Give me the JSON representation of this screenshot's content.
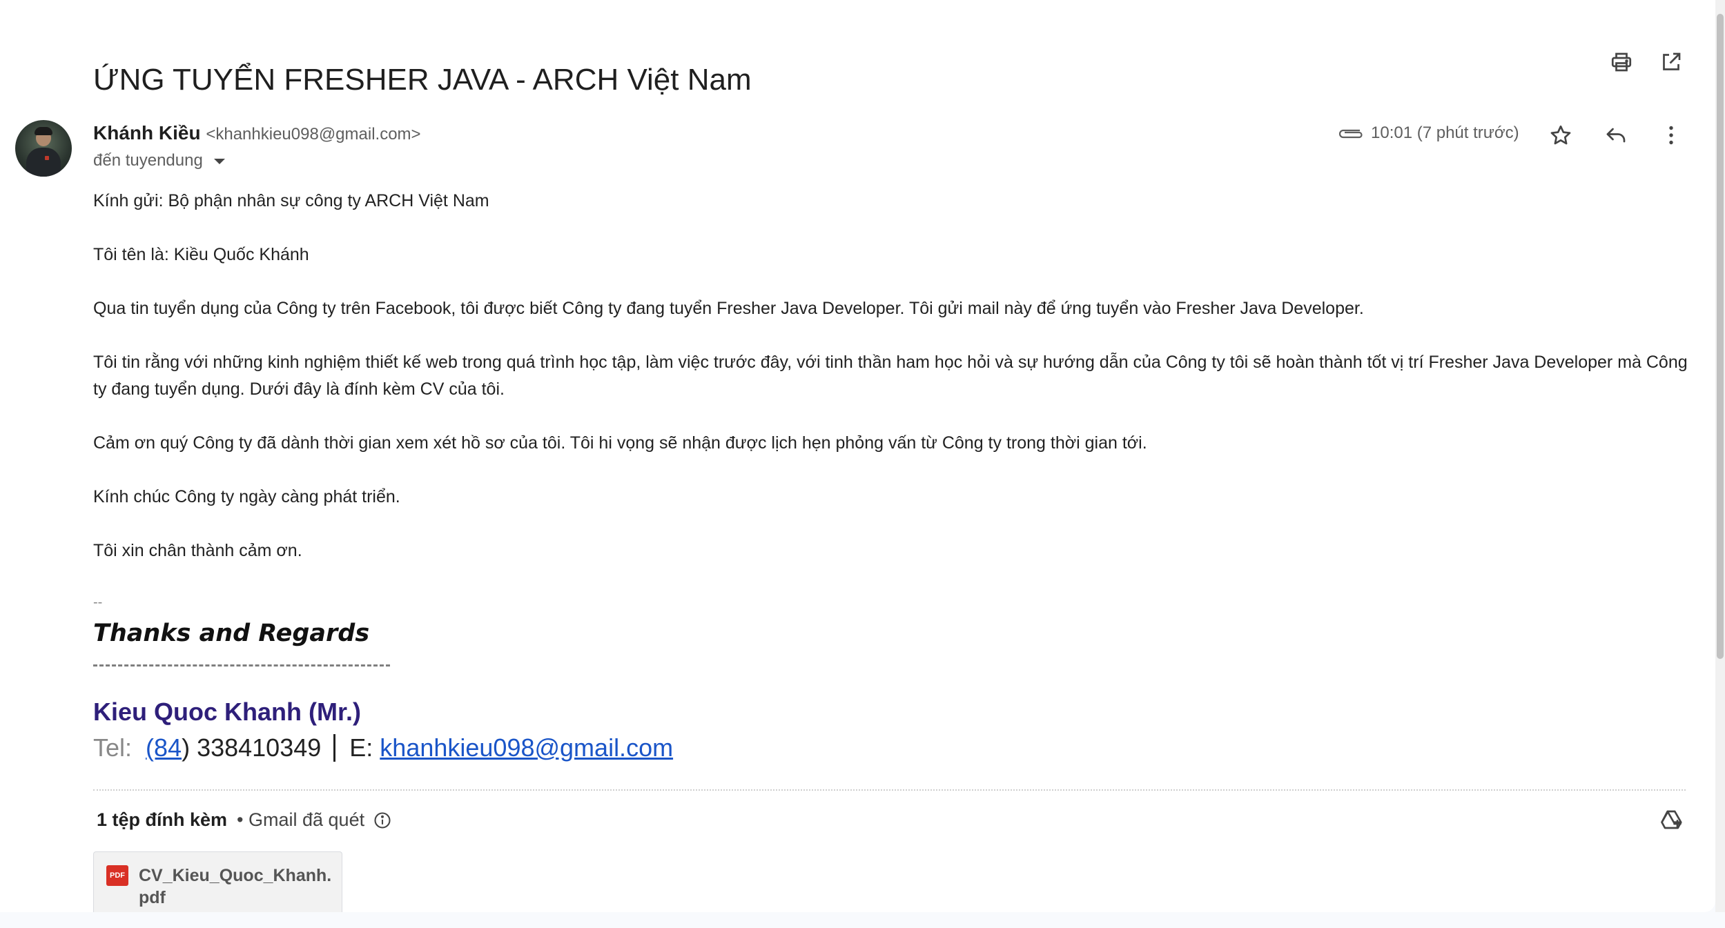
{
  "email": {
    "subject": "ỨNG TUYỂN FRESHER JAVA - ARCH Việt Nam",
    "sender_name": "Khánh Kiều",
    "sender_email": "<khanhkieu098@gmail.com>",
    "to_line": "đến tuyendung",
    "time": "10:01 (7 phút trước)",
    "body": [
      "Kính gửi: Bộ phận nhân sự công ty ARCH Việt Nam",
      "Tôi tên là: Kiều Quốc Khánh",
      "Qua tin tuyển dụng của Công ty trên Facebook, tôi được biết Công ty đang tuyển Fresher Java Developer. Tôi gửi mail này để ứng tuyển vào Fresher Java Developer.",
      "Tôi tin rằng với những kinh nghiệm thiết kế web trong quá trình học tập, làm việc trước đây, với tinh thần ham học hỏi và sự hướng dẫn của Công ty tôi sẽ hoàn thành tốt vị trí Fresher Java  Developer mà Công ty đang tuyển dụng. Dưới đây là đính kèm CV của tôi.",
      "Cảm ơn quý Công ty đã dành thời gian xem xét hồ sơ của tôi. Tôi hi vọng sẽ nhận được lịch hẹn phỏng vấn từ Công ty trong thời gian tới.",
      "Kính chúc Công ty ngày càng phát triển.",
      "Tôi xin chân thành cảm ơn."
    ]
  },
  "signature": {
    "separator": "--",
    "thanks": "Thanks and Regards",
    "name": "Kieu Quoc Khanh (Mr.)",
    "tel_label": "Tel:",
    "tel_code": "(84",
    "tel_rest": ") 338410349",
    "email_label": "E:",
    "email": "khanhkieu098@gmail.com"
  },
  "attachments": {
    "count_label": "1 tệp đính kèm",
    "scan_label": "• Gmail đã quét",
    "files": [
      {
        "name": "CV_Kieu_Quoc_Khanh.pdf",
        "icon_text": "PDF"
      }
    ]
  },
  "icons": {
    "print": "print-icon",
    "open_new_window": "open-in-new-window-icon",
    "attachment": "paperclip-icon",
    "star": "star-icon",
    "reply": "reply-icon",
    "more": "more-vert-icon",
    "info": "info-icon",
    "drive": "add-to-drive-icon"
  },
  "colors": {
    "signature_name": "#2e1f7a",
    "link": "#1a55c8",
    "pdf_badge": "#d93025"
  }
}
